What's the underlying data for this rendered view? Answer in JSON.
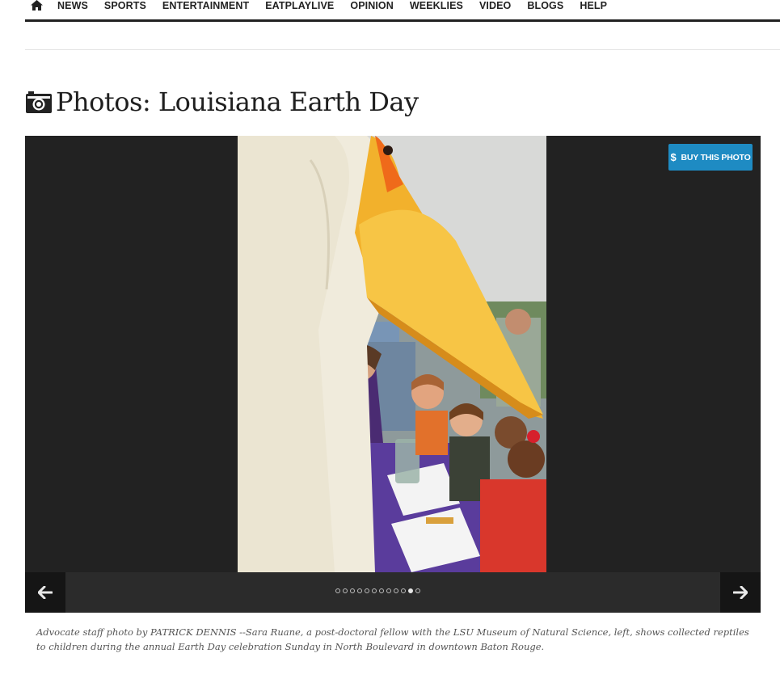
{
  "nav": {
    "home_icon": "home-icon",
    "items": [
      "NEWS",
      "SPORTS",
      "ENTERTAINMENT",
      "EATPLAYLIVE",
      "OPINION",
      "WEEKLIES",
      "VIDEO",
      "BLOGS",
      "HELP"
    ]
  },
  "page": {
    "title_icon": "camera-icon",
    "title": "Photos: Louisiana Earth Day"
  },
  "gallery": {
    "buy_icon": "dollar-icon",
    "buy_label": "BUY THIS PHOTO",
    "prev_icon": "arrow-left-icon",
    "next_icon": "arrow-right-icon",
    "slide_count": 12,
    "active_slide": 11,
    "colors": {
      "background": "#222222",
      "controls": "#2b2b2b",
      "buy_button": "#1e8bc3"
    }
  },
  "caption": {
    "text": "Advocate staff photo by PATRICK DENNIS --Sara Ruane, a post-doctoral fellow with the LSU Museum of Natural Science, left, shows collected reptiles to children during the annual Earth Day celebration Sunday in North Boulevard in downtown Baton Rouge."
  }
}
